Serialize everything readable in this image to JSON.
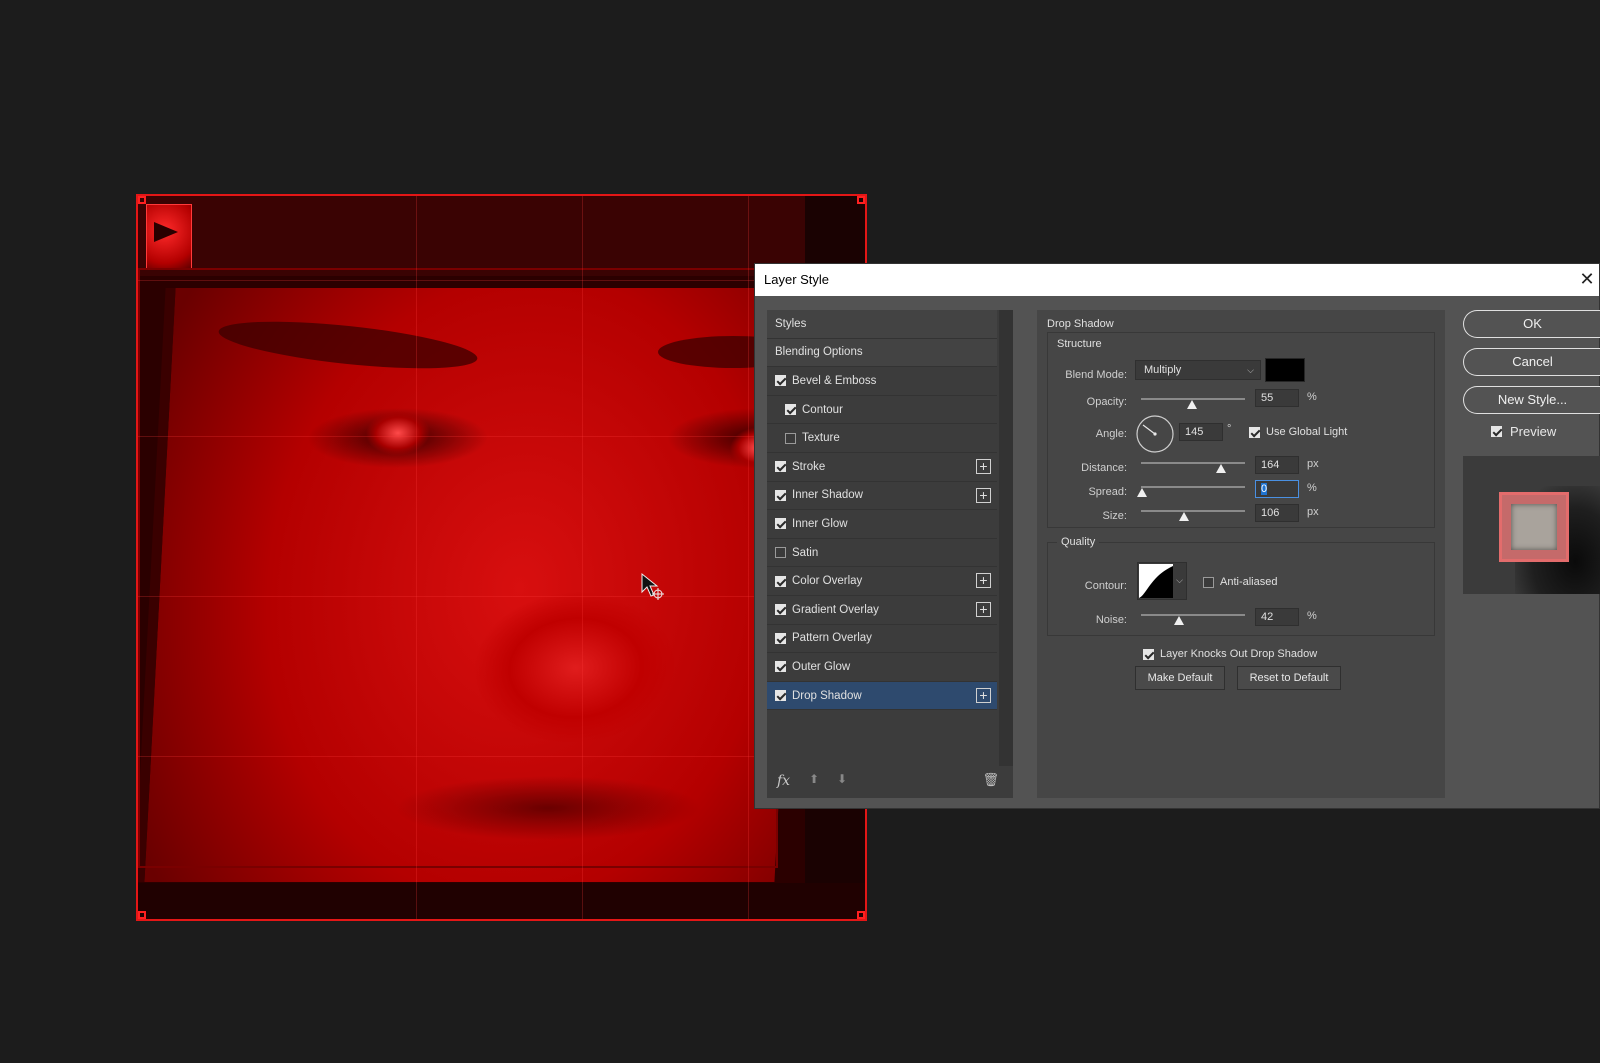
{
  "dialog": {
    "title": "Layer Style",
    "close_glyph": "✕"
  },
  "styles_list": {
    "items": [
      {
        "label": "Styles",
        "type": "header"
      },
      {
        "label": "Blending Options",
        "type": "header"
      },
      {
        "label": "Bevel & Emboss",
        "checked": true
      },
      {
        "label": "Contour",
        "checked": true,
        "sub": true
      },
      {
        "label": "Texture",
        "checked": false,
        "sub": true
      },
      {
        "label": "Stroke",
        "checked": true,
        "plus": true
      },
      {
        "label": "Inner Shadow",
        "checked": true,
        "plus": true
      },
      {
        "label": "Inner Glow",
        "checked": true
      },
      {
        "label": "Satin",
        "checked": false
      },
      {
        "label": "Color Overlay",
        "checked": true,
        "plus": true
      },
      {
        "label": "Gradient Overlay",
        "checked": true,
        "plus": true
      },
      {
        "label": "Pattern Overlay",
        "checked": true
      },
      {
        "label": "Outer Glow",
        "checked": true
      },
      {
        "label": "Drop Shadow",
        "checked": true,
        "plus": true,
        "selected": true
      }
    ],
    "footer": {
      "fx": "fx",
      "up_glyph": "⬆",
      "down_glyph": "⬇",
      "trash_glyph": "🗑"
    }
  },
  "drop_shadow": {
    "section_title": "Drop Shadow",
    "structure": {
      "title": "Structure",
      "blend_mode_label": "Blend Mode:",
      "blend_mode_value": "Multiply",
      "shadow_color": "#000000",
      "opacity_label": "Opacity:",
      "opacity_value": "55",
      "opacity_unit": "%",
      "angle_label": "Angle:",
      "angle_value": "145",
      "angle_unit": "°",
      "use_global_light_label": "Use Global Light",
      "use_global_light": true,
      "distance_label": "Distance:",
      "distance_value": "164",
      "distance_unit": "px",
      "spread_label": "Spread:",
      "spread_value": "0",
      "spread_unit": "%",
      "size_label": "Size:",
      "size_value": "106",
      "size_unit": "px"
    },
    "quality": {
      "title": "Quality",
      "contour_label": "Contour:",
      "anti_aliased_label": "Anti-aliased",
      "anti_aliased": false,
      "noise_label": "Noise:",
      "noise_value": "42",
      "noise_unit": "%"
    },
    "knockout_label": "Layer Knocks Out Drop Shadow",
    "knockout": true,
    "make_default_label": "Make Default",
    "reset_default_label": "Reset to Default"
  },
  "buttons": {
    "ok": "OK",
    "cancel": "Cancel",
    "new_style": "New Style...",
    "preview_label": "Preview",
    "preview_checked": true
  }
}
